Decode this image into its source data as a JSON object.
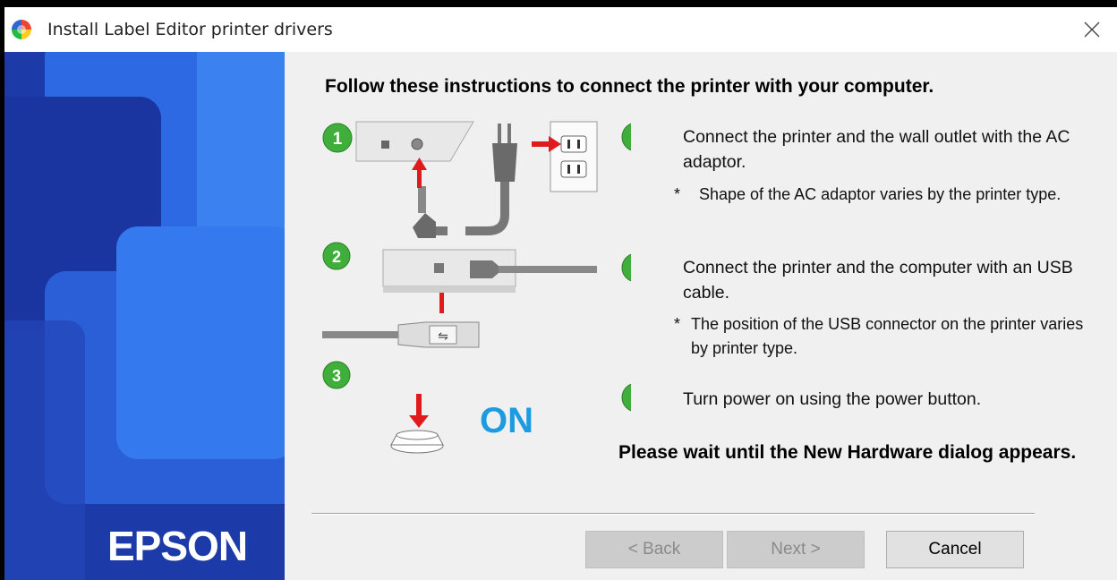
{
  "window": {
    "title": "Install Label Editor printer drivers",
    "close_icon": "close-icon"
  },
  "sidebar": {
    "brand": "EPSON",
    "colors": {
      "base": "#1e3fae",
      "light": "#2f6fe8",
      "mid": "#2452c8"
    }
  },
  "main": {
    "heading": "Follow these instructions to connect the printer with your computer.",
    "steps": [
      {
        "number": "1",
        "text": "Connect the printer and the wall outlet with the AC adaptor.",
        "note_mark": "*",
        "note": "Shape of the AC adaptor varies by the printer type."
      },
      {
        "number": "2",
        "text": "Connect the printer and the computer with an USB cable.",
        "note_mark": "*",
        "note": "The position of the USB connector on the printer varies by printer type."
      },
      {
        "number": "3",
        "text": "Turn power on using the power button."
      }
    ],
    "illustration": {
      "on_label": "ON",
      "on_color": "#1d9be0",
      "arrow_color": "#e01b1b",
      "badge_color": "#3fae3a"
    },
    "wait_message": "Please wait until the New Hardware dialog appears."
  },
  "buttons": {
    "back": "< Back",
    "next": "Next >",
    "cancel": "Cancel"
  }
}
